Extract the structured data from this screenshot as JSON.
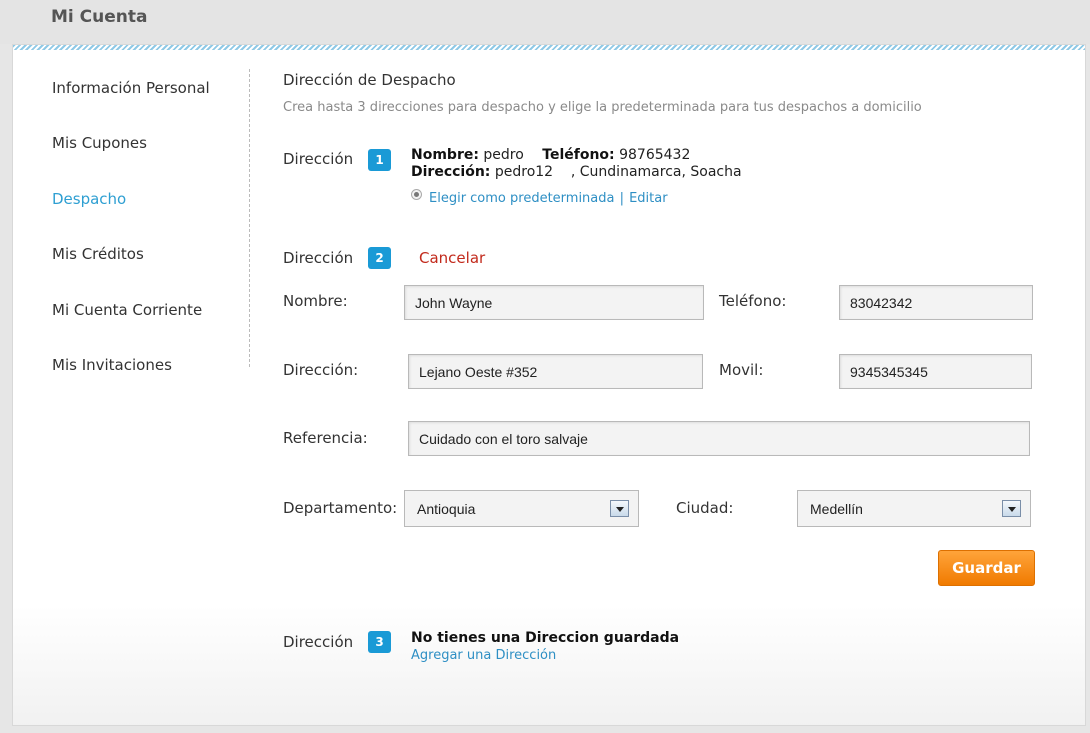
{
  "page": {
    "title": "Mi Cuenta"
  },
  "sidebar": {
    "items": [
      {
        "label": "Información Personal"
      },
      {
        "label": "Mis Cupones"
      },
      {
        "label": "Despacho",
        "active": true
      },
      {
        "label": "Mis Créditos"
      },
      {
        "label": "Mi Cuenta Corriente"
      },
      {
        "label": "Mis Invitaciones"
      }
    ]
  },
  "main": {
    "title": "Dirección de Despacho",
    "subtitle": "Crea hasta 3 direcciones para despacho y elige la predeterminada para tus despachos a domicilio",
    "address1": {
      "label": "Dirección",
      "number": "1",
      "name_label": "Nombre:",
      "name": "pedro",
      "phone_label": "Teléfono:",
      "phone": "98765432",
      "address_label": "Dirección:",
      "address": "pedro12    , Cundinamarca, Soacha",
      "default_link": "Elegir como predeterminada",
      "separator": "|",
      "edit_link": "Editar"
    },
    "address2": {
      "label": "Dirección",
      "number": "2",
      "cancel": "Cancelar",
      "form": {
        "name_label": "Nombre:",
        "name_value": "John Wayne",
        "phone_label": "Teléfono:",
        "phone_value": "83042342",
        "address_label": "Dirección:",
        "address_value": "Lejano Oeste #352",
        "mobile_label": "Movil:",
        "mobile_value": "9345345345",
        "reference_label": "Referencia:",
        "reference_value": "Cuidado con el toro salvaje",
        "department_label": "Departamento:",
        "department_value": "Antioquia",
        "city_label": "Ciudad:",
        "city_value": "Medellín",
        "save_label": "Guardar"
      }
    },
    "address3": {
      "label": "Dirección",
      "number": "3",
      "empty_title": "No tienes una Direccion guardada",
      "add_link": "Agregar una Dirección"
    }
  },
  "colors": {
    "accent": "#1a9ad6",
    "link": "#2e8fc4",
    "cancel": "#c22a1c",
    "save": "#f68b1f"
  }
}
